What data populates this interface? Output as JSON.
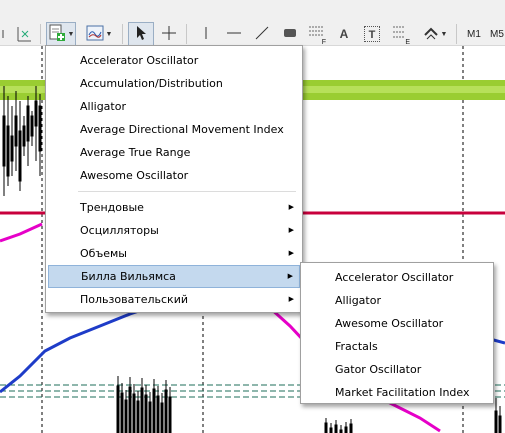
{
  "toolbar": {
    "timeframe_m1": "M1",
    "timeframe_m5": "M5",
    "text_tool": "A",
    "text_label_tool": "T",
    "fibonacci_letter": "F",
    "elliott_letter": "E",
    "colors": {
      "add_indicator_green": "#2eaa3a",
      "pressed_bg": "#dfe6ee"
    }
  },
  "indicator_menu": {
    "items": [
      {
        "label": "Accelerator Oscillator"
      },
      {
        "label": "Accumulation/Distribution"
      },
      {
        "label": "Alligator"
      },
      {
        "label": "Average Directional Movement Index"
      },
      {
        "label": "Average True Range"
      },
      {
        "label": "Awesome Oscillator"
      }
    ],
    "groups": [
      {
        "label": "Трендовые",
        "has_submenu": true
      },
      {
        "label": "Осцилляторы",
        "has_submenu": true
      },
      {
        "label": "Объемы",
        "has_submenu": true
      },
      {
        "label": "Билла Вильямса",
        "has_submenu": true,
        "highlighted": true
      },
      {
        "label": "Пользовательский",
        "has_submenu": true
      }
    ]
  },
  "bill_williams_submenu": {
    "items": [
      {
        "label": "Accelerator Oscillator"
      },
      {
        "label": "Alligator"
      },
      {
        "label": "Awesome Oscillator"
      },
      {
        "label": "Fractals"
      },
      {
        "label": "Gator Oscillator"
      },
      {
        "label": "Market Facilitation Index"
      }
    ]
  },
  "chart_colors": {
    "zone_band": "#9acd32",
    "red_level": "#c8003c",
    "blue_line": "#1e3cc8",
    "magenta_line": "#e600c8",
    "dashed_levels": "#1e6e5a",
    "candles": "#000000",
    "period_separators": "#000000"
  }
}
